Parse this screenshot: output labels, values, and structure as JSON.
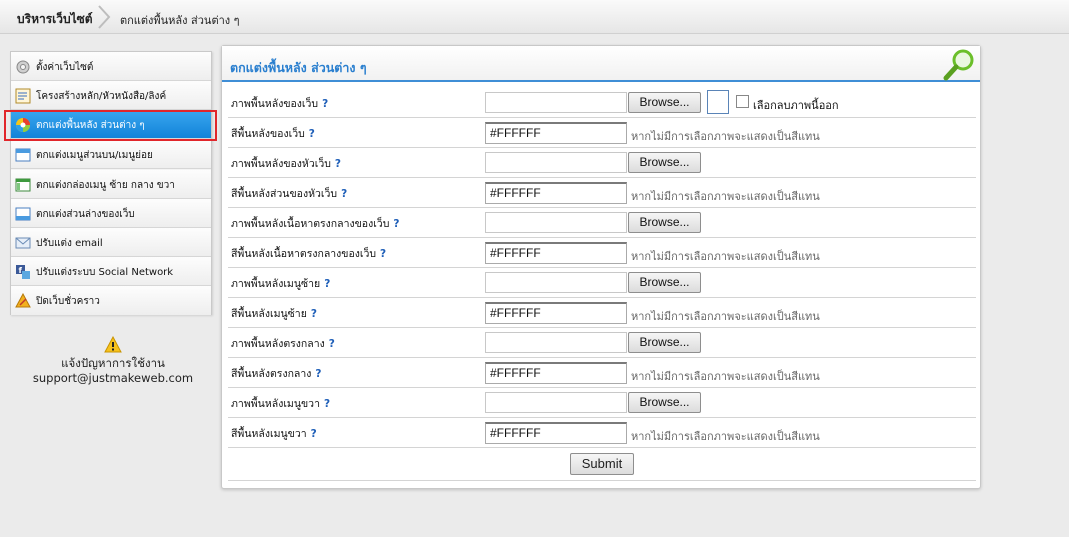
{
  "breadcrumb": {
    "home": "บริหารเว็บไซต์",
    "current": "ตกแต่งพื้นหลัง ส่วนต่าง ๆ"
  },
  "sidebar": {
    "items": [
      {
        "label": "ตั้งค่าเว็บไซต์",
        "icon": "gear-icon"
      },
      {
        "label": "โครงสร้างหลัก/หัวหนังสือ/ลิงค์",
        "icon": "form-icon"
      },
      {
        "label": "ตกแต่งพื้นหลัง ส่วนต่าง ๆ",
        "icon": "color-wheel-icon",
        "active": true
      },
      {
        "label": "ตกแต่งเมนูส่วนบน/เมนูย่อย",
        "icon": "window-top-icon"
      },
      {
        "label": "ตกแต่งกล่องเมนู ซ้าย กลาง ขวา",
        "icon": "window-columns-icon"
      },
      {
        "label": "ตกแต่งส่วนล่างของเว็บ",
        "icon": "window-bottom-icon"
      },
      {
        "label": "ปรับแต่ง email",
        "icon": "email-icon"
      },
      {
        "label": "ปรับแต่งระบบ Social Network",
        "icon": "social-network-icon"
      },
      {
        "label": "ปิดเว็บชั่วคราว",
        "icon": "warning-tools-icon"
      }
    ]
  },
  "support": {
    "line1": "แจ้งปัญหาการใช้งาน",
    "email": "support@justmakeweb.com"
  },
  "panel": {
    "title": "ตกแต่งพื้นหลัง ส่วนต่าง ๆ",
    "browse_label": "Browse...",
    "color_note": "หากไม่มีการเลือกภาพจะแสดงเป็นสีแทน",
    "remove_image_label": "เลือกลบภาพนี้ออก",
    "submit_label": "Submit",
    "rows": [
      {
        "label": "ภาพพื้นหลังของเว็บ",
        "type": "file"
      },
      {
        "label": "สีพื้นหลังของเว็บ",
        "type": "color",
        "value": "#FFFFFF"
      },
      {
        "label": "ภาพพื้นหลังของหัวเว็บ",
        "type": "file"
      },
      {
        "label": "สีพื้นหลังส่วนของหัวเว็บ",
        "type": "color",
        "value": "#FFFFFF"
      },
      {
        "label": "ภาพพื้นหลังเนื้อหาตรงกลางของเว็บ",
        "type": "file"
      },
      {
        "label": "สีพื้นหลังเนื้อหาตรงกลางของเว็บ",
        "type": "color",
        "value": "#FFFFFF"
      },
      {
        "label": "ภาพพื้นหลังเมนูซ้าย",
        "type": "file"
      },
      {
        "label": "สีพื้นหลังเมนูซ้าย",
        "type": "color",
        "value": "#FFFFFF"
      },
      {
        "label": "ภาพพื้นหลังตรงกลาง",
        "type": "file"
      },
      {
        "label": "สีพื้นหลังตรงกลาง",
        "type": "color",
        "value": "#FFFFFF"
      },
      {
        "label": "ภาพพื้นหลังเมนูขวา",
        "type": "file"
      },
      {
        "label": "สีพื้นหลังเมนูขวา",
        "type": "color",
        "value": "#FFFFFF"
      }
    ],
    "help_mark": "?"
  },
  "colors": {
    "accent": "#2a7fcf",
    "active_item": "#1a8be0",
    "highlight_outline": "#e1262b"
  }
}
